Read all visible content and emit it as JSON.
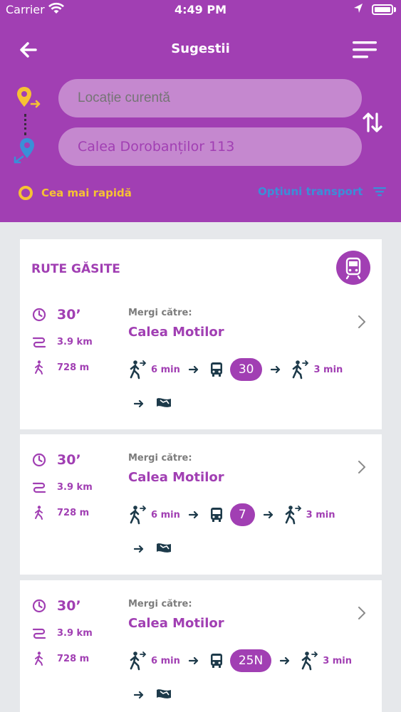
{
  "status_bar": {
    "carrier": "Carrier",
    "time": "4:49 PM"
  },
  "header": {
    "title": "Sugestii",
    "from_placeholder": "Locație curentă",
    "to_value": "Calea Dorobanților 113",
    "fastest_label": "Cea mai rapidă",
    "transport_options_label": "Opțiuni transport"
  },
  "routes": {
    "title": "RUTE GĂSITE",
    "items": [
      {
        "time": "30’",
        "distance": "3.9 km",
        "walk_total": "728 m",
        "goto_label": "Mergi către:",
        "destination": "Calea Motilor",
        "walk_start": "6 min",
        "line": "30",
        "walk_end": "3 min"
      },
      {
        "time": "30’",
        "distance": "3.9 km",
        "walk_total": "728 m",
        "goto_label": "Mergi către:",
        "destination": "Calea Motilor",
        "walk_start": "6 min",
        "line": "7",
        "walk_end": "3 min"
      },
      {
        "time": "30’",
        "distance": "3.9 km",
        "walk_total": "728 m",
        "goto_label": "Mergi către:",
        "destination": "Calea Motilor",
        "walk_start": "6 min",
        "line": "25N",
        "walk_end": "3 min"
      }
    ]
  },
  "colors": {
    "primary": "#a13fb3",
    "accent_yellow": "#f6c233",
    "accent_blue": "#3a8fd8",
    "field_bg": "#c588cf",
    "page_bg": "#e6e8eb"
  }
}
